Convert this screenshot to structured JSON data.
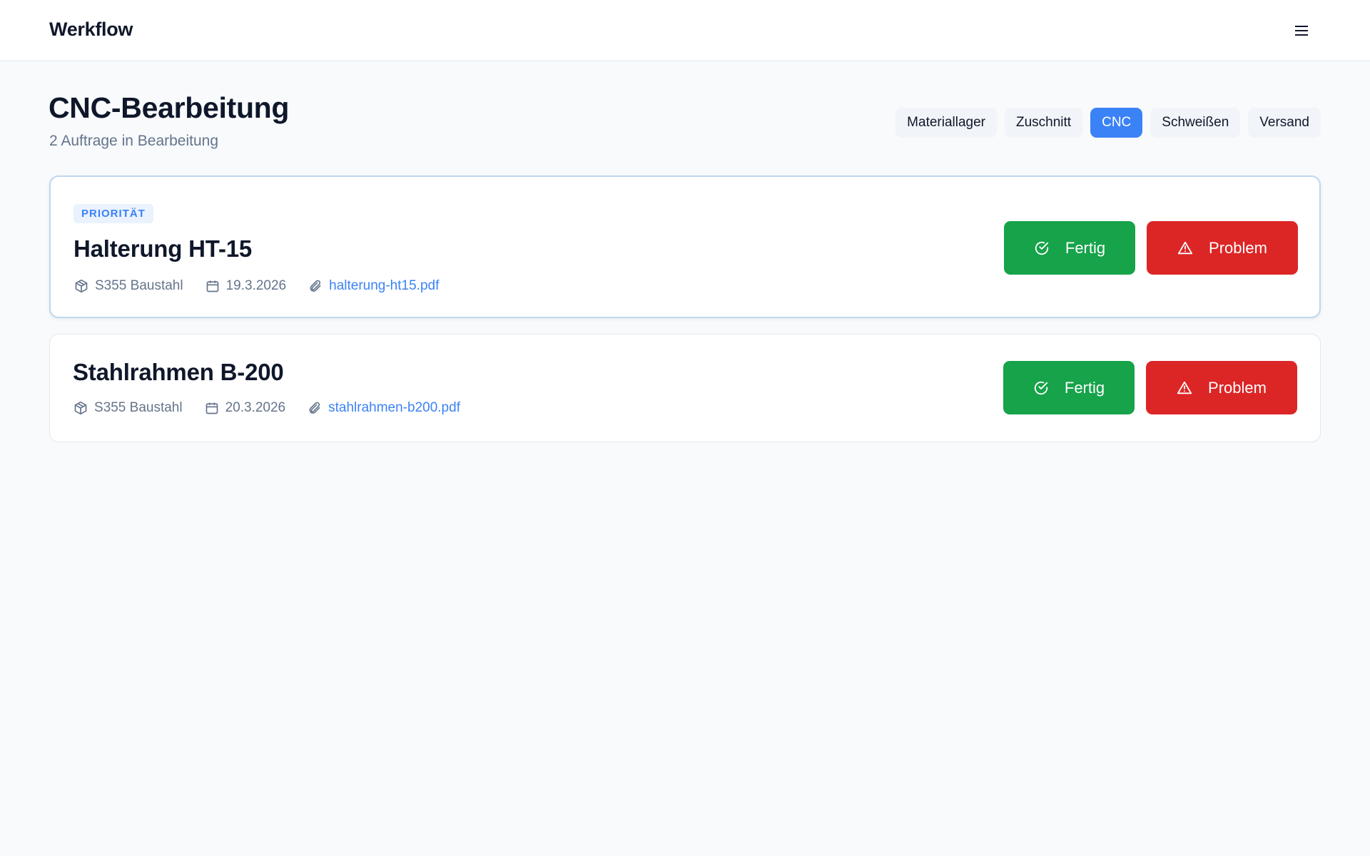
{
  "app": {
    "brand": "Werkflow",
    "menu_icon": "hamburger-icon"
  },
  "header": {
    "title": "CNC-Bearbeitung",
    "subtitle": "2 Auftrage in Bearbeitung"
  },
  "stations": [
    {
      "label": "Materiallager",
      "active": false
    },
    {
      "label": "Zuschnitt",
      "active": false
    },
    {
      "label": "CNC",
      "active": true
    },
    {
      "label": "Schweißen",
      "active": false
    },
    {
      "label": "Versand",
      "active": false
    }
  ],
  "orders": [
    {
      "badge": "PRIORITÄT",
      "title": "Halterung HT-15",
      "material": "S355 Baustahl",
      "date": "19.3.2026",
      "file": "halterung-ht15.pdf",
      "done_label": "Fertig",
      "problem_label": "Problem"
    },
    {
      "title": "Stahlrahmen B-200",
      "material": "S355 Baustahl",
      "date": "20.3.2026",
      "file": "stahlrahmen-b200.pdf",
      "done_label": "Fertig",
      "problem_label": "Problem"
    }
  ],
  "colors": {
    "accent": "#3b82f6",
    "done": "#16a34a",
    "problem": "#dc2626",
    "priority_border": "#bfd7f1"
  }
}
